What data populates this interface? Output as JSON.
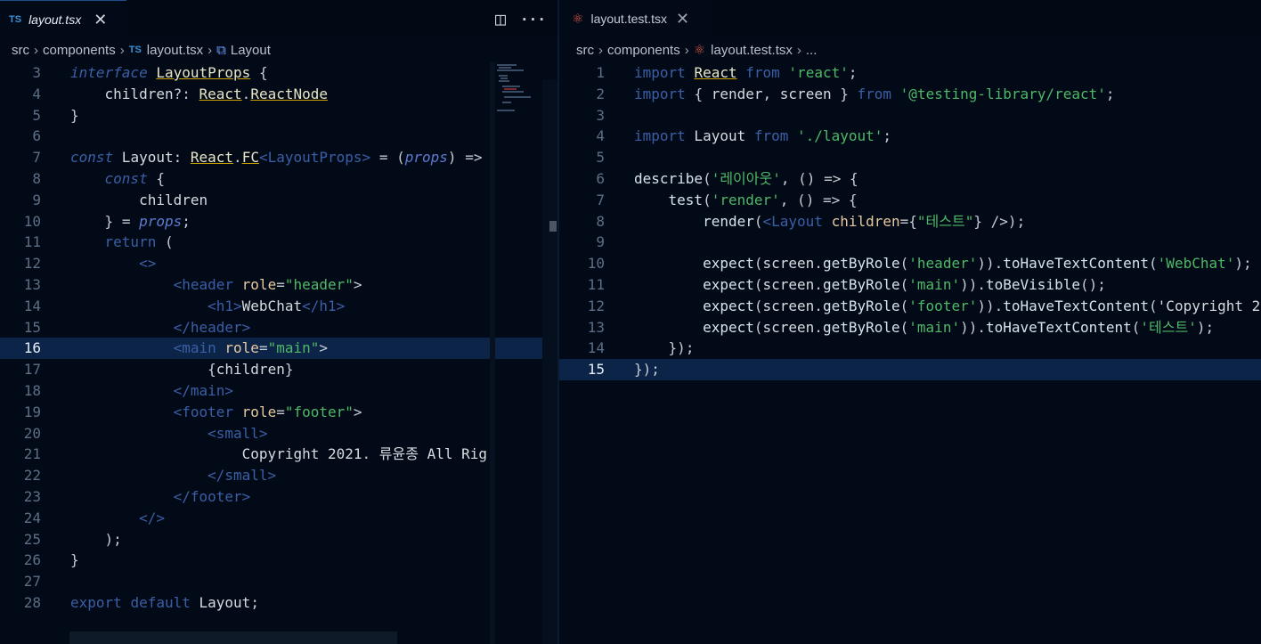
{
  "left": {
    "tab": {
      "icon": "TS",
      "name": "layout.tsx",
      "close": "✕"
    },
    "actions": {
      "split_icon": "◫",
      "more_icon": "···"
    },
    "breadcrumb": {
      "seg1": "src",
      "seg2": "components",
      "file_icon": "TS",
      "seg3": "layout.tsx",
      "symbol_icon": "⧉",
      "seg4": "Layout"
    },
    "lines": [
      {
        "n": "3",
        "t": "interface LayoutProps {"
      },
      {
        "n": "4",
        "t": "    children?: React.ReactNode"
      },
      {
        "n": "5",
        "t": "}"
      },
      {
        "n": "6",
        "t": ""
      },
      {
        "n": "7",
        "t": "const Layout: React.FC<LayoutProps> = (props) =>"
      },
      {
        "n": "8",
        "t": "    const {"
      },
      {
        "n": "9",
        "t": "        children"
      },
      {
        "n": "10",
        "t": "    } = props;"
      },
      {
        "n": "11",
        "t": "    return ("
      },
      {
        "n": "12",
        "t": "        <>"
      },
      {
        "n": "13",
        "t": "            <header role=\"header\">"
      },
      {
        "n": "14",
        "t": "                <h1>WebChat</h1>"
      },
      {
        "n": "15",
        "t": "            </header>"
      },
      {
        "n": "16",
        "t": "            <main role=\"main\">"
      },
      {
        "n": "17",
        "t": "                {children}"
      },
      {
        "n": "18",
        "t": "            </main>"
      },
      {
        "n": "19",
        "t": "            <footer role=\"footer\">"
      },
      {
        "n": "20",
        "t": "                <small>"
      },
      {
        "n": "21",
        "t": "                    Copyright 2021. 류윤종 All Rig"
      },
      {
        "n": "22",
        "t": "                </small>"
      },
      {
        "n": "23",
        "t": "            </footer>"
      },
      {
        "n": "24",
        "t": "        </>"
      },
      {
        "n": "25",
        "t": "    );"
      },
      {
        "n": "26",
        "t": "}"
      },
      {
        "n": "27",
        "t": ""
      },
      {
        "n": "28",
        "t": "export default Layout;"
      }
    ]
  },
  "right": {
    "tab": {
      "icon": "⚛",
      "name": "layout.test.tsx",
      "close": "✕"
    },
    "breadcrumb": {
      "seg1": "src",
      "seg2": "components",
      "file_icon": "⚛",
      "seg3": "layout.test.tsx",
      "seg4": "..."
    },
    "lines": [
      {
        "n": "1",
        "t": "import React from 'react';"
      },
      {
        "n": "2",
        "t": "import { render, screen } from '@testing-library/react';"
      },
      {
        "n": "3",
        "t": ""
      },
      {
        "n": "4",
        "t": "import Layout from './layout';"
      },
      {
        "n": "5",
        "t": ""
      },
      {
        "n": "6",
        "t": "describe('레이아웃', () => {"
      },
      {
        "n": "7",
        "t": "    test('render', () => {"
      },
      {
        "n": "8",
        "t": "        render(<Layout children={\"테스트\"} />);"
      },
      {
        "n": "9",
        "t": ""
      },
      {
        "n": "10",
        "t": "        expect(screen.getByRole('header')).toHaveTextContent('WebChat');"
      },
      {
        "n": "11",
        "t": "        expect(screen.getByRole('main')).toBeVisible();"
      },
      {
        "n": "12",
        "t": "        expect(screen.getByRole('footer')).toHaveTextContent('Copyright 20"
      },
      {
        "n": "13",
        "t": "        expect(screen.getByRole('main')).toHaveTextContent('테스트');"
      },
      {
        "n": "14",
        "t": "    });"
      },
      {
        "n": "15",
        "t": "});"
      }
    ]
  },
  "colors": {
    "background": "#020a17",
    "keyword": "#3b5fa6",
    "string": "#4fb867",
    "current_line": "#0b2448"
  }
}
